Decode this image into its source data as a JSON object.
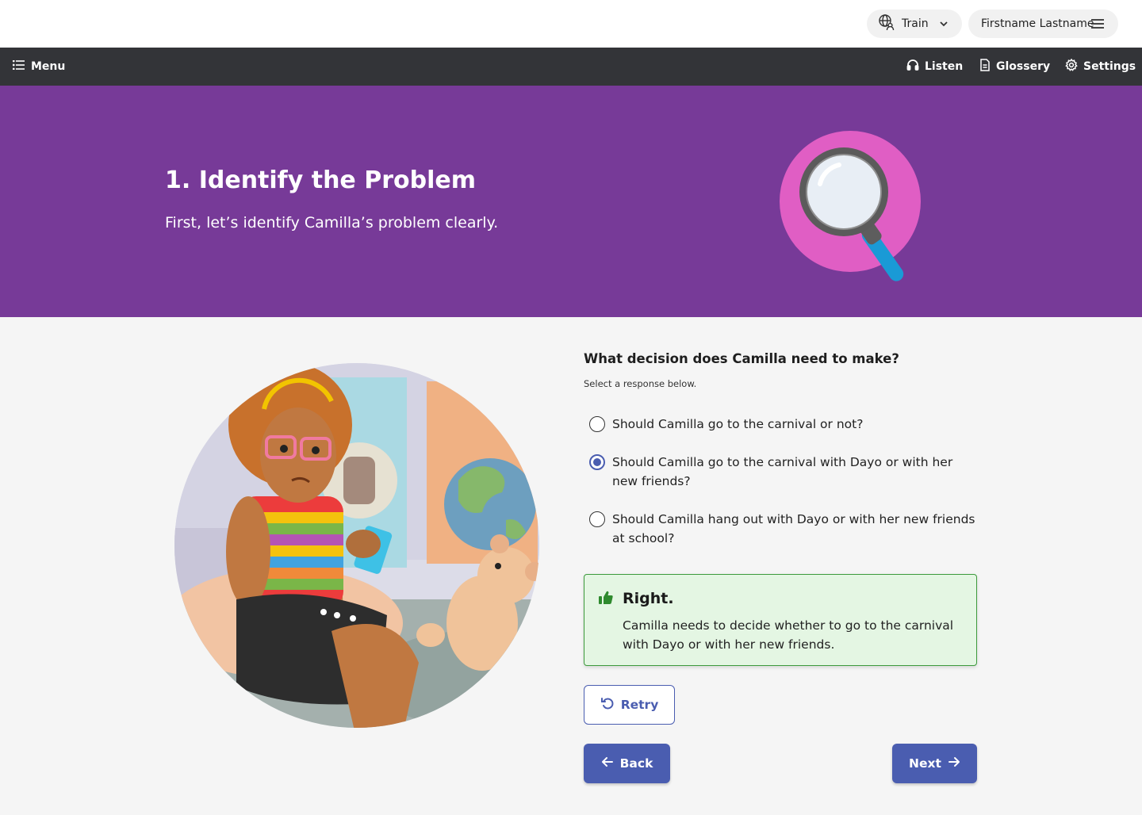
{
  "topbar": {
    "mode_label": "Train",
    "user_name": "Firstname Lastname"
  },
  "nav": {
    "menu_label": "Menu",
    "listen_label": "Listen",
    "glossery_label": "Glossery",
    "settings_label": "Settings"
  },
  "hero": {
    "title": "1. Identify the Problem",
    "subtitle": "First, let’s identify Camilla’s problem clearly.",
    "background": "#773a98",
    "icon": "magnifying-glass-icon"
  },
  "question": {
    "prompt": "What decision does Camilla need to make?",
    "hint": "Select a response below.",
    "options": [
      {
        "label": "Should Camilla go to the carnival or not?",
        "selected": false
      },
      {
        "label": "Should Camilla go to the carnival with Dayo or with her new friends?",
        "selected": true
      },
      {
        "label": "Should Camilla hang out with Dayo or with her new friends at school?",
        "selected": false
      }
    ]
  },
  "feedback": {
    "title": "Right.",
    "text": "Camilla needs to decide whether to go to the carnival with Dayo or with her new friends.",
    "icon": "thumbs-up-icon",
    "color": "#3c9a3c"
  },
  "buttons": {
    "retry_label": "Retry",
    "back_label": "Back",
    "next_label": "Next",
    "accent": "#4a5db0"
  }
}
